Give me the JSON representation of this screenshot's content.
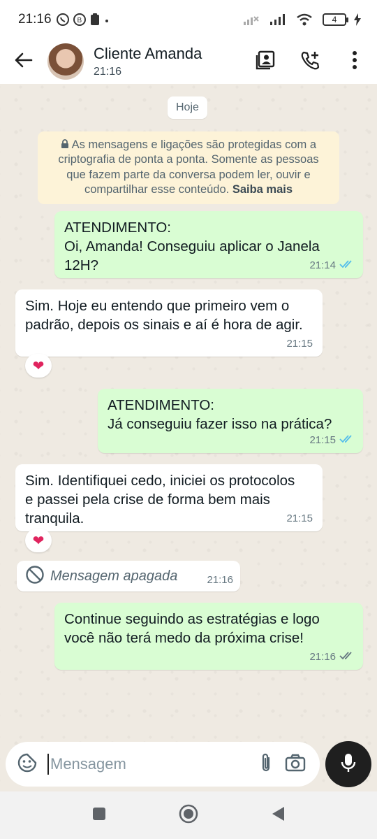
{
  "status_bar": {
    "time": "21:16",
    "battery": "4",
    "left_icons": [
      "whatsapp-icon",
      "whatsapp-business-icon",
      "clipboard-icon",
      "dot-icon"
    ],
    "right_icons": [
      "signal-icon",
      "signal-icon",
      "wifi-icon",
      "battery-icon",
      "charging-icon"
    ]
  },
  "header": {
    "contact_name": "Cliente Amanda",
    "contact_status": "21:16",
    "icons": [
      "back-arrow-icon",
      "contact-card-icon",
      "add-call-icon",
      "more-vert-icon"
    ]
  },
  "chat": {
    "day_label": "Hoje",
    "encryption_notice": "As mensagens e ligações são protegidas com a criptografia de ponta a ponta. Somente as pessoas que fazem parte da conversa podem ler, ouvir e compartilhar esse conteúdo.",
    "encryption_link": "Saiba mais",
    "messages": [
      {
        "direction": "out",
        "line1": "ATENDIMENTO:",
        "text": "Oi, Amanda! Conseguiu aplicar o Janela 12H?",
        "time": "21:14",
        "ticks": "read"
      },
      {
        "direction": "in",
        "text": "Sim. Hoje eu entendo que primeiro vem o padrão, depois os sinais e aí é hora de agir.",
        "time": "21:15",
        "reaction": "❤"
      },
      {
        "direction": "out",
        "line1": "ATENDIMENTO:",
        "text": "Já conseguiu fazer isso na prática?",
        "time": "21:15",
        "ticks": "read"
      },
      {
        "direction": "in",
        "text": "Sim. Identifiquei cedo, iniciei os protocolos e passei pela crise de forma bem mais tranquila.",
        "time": "21:15",
        "reaction": "❤"
      },
      {
        "direction": "in",
        "deleted": true,
        "text": "Mensagem apagada",
        "time": "21:16"
      },
      {
        "direction": "out",
        "text": "Continue seguindo as estratégias e logo você não terá medo da próxima crise!",
        "time": "21:16",
        "ticks": "delivered"
      }
    ],
    "colors": {
      "outgoing": "#d9fdd3",
      "incoming": "#ffffff",
      "read_ticks": "#53bdeb",
      "background": "#efeae2"
    }
  },
  "composer": {
    "placeholder": "Mensagem",
    "icons": [
      "sticker-icon",
      "attach-icon",
      "camera-icon",
      "mic-icon"
    ]
  },
  "navigation": {
    "icons": [
      "recents-icon",
      "home-icon",
      "back-triangle-icon"
    ]
  }
}
